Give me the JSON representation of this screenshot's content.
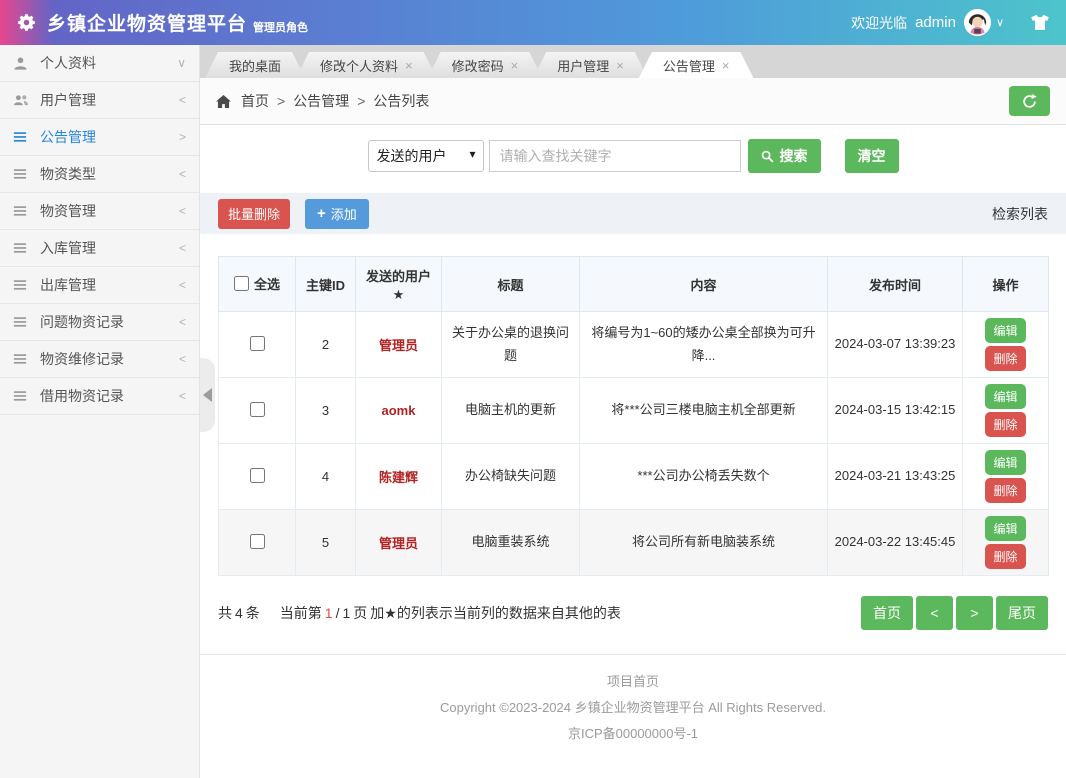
{
  "header": {
    "title": "乡镇企业物资管理平台",
    "role_badge": "管理员角色",
    "welcome": "欢迎光临",
    "username": "admin"
  },
  "sidebar": {
    "items": [
      {
        "label": "个人资料",
        "icon": "user-icon",
        "chevron": "∨",
        "active": false
      },
      {
        "label": "用户管理",
        "icon": "users-icon",
        "chevron": "<",
        "active": false
      },
      {
        "label": "公告管理",
        "icon": "menu-icon",
        "chevron": ">",
        "active": true
      },
      {
        "label": "物资类型",
        "icon": "menu-icon",
        "chevron": "<",
        "active": false
      },
      {
        "label": "物资管理",
        "icon": "menu-icon",
        "chevron": "<",
        "active": false
      },
      {
        "label": "入库管理",
        "icon": "menu-icon",
        "chevron": "<",
        "active": false
      },
      {
        "label": "出库管理",
        "icon": "menu-icon",
        "chevron": "<",
        "active": false
      },
      {
        "label": "问题物资记录",
        "icon": "menu-icon",
        "chevron": "<",
        "active": false
      },
      {
        "label": "物资维修记录",
        "icon": "menu-icon",
        "chevron": "<",
        "active": false
      },
      {
        "label": "借用物资记录",
        "icon": "menu-icon",
        "chevron": "<",
        "active": false
      }
    ]
  },
  "tabs": [
    {
      "label": "我的桌面",
      "closable": false,
      "active": false
    },
    {
      "label": "修改个人资料",
      "closable": true,
      "active": false
    },
    {
      "label": "修改密码",
      "closable": true,
      "active": false
    },
    {
      "label": "用户管理",
      "closable": true,
      "active": false
    },
    {
      "label": "公告管理",
      "closable": true,
      "active": true
    }
  ],
  "tab_close_glyph": "×",
  "breadcrumb": {
    "items": [
      "首页",
      "公告管理",
      "公告列表"
    ],
    "separator": ">"
  },
  "search": {
    "select_value": "发送的用户",
    "input_placeholder": "请输入查找关键字",
    "search_label": "搜索",
    "clear_label": "清空"
  },
  "toolbar": {
    "batch_delete_label": "批量删除",
    "add_plus": "+",
    "add_label": "添加",
    "list_hint": "检索列表"
  },
  "table": {
    "select_all_label": "全选",
    "columns": [
      {
        "label": "主键ID",
        "starred": false
      },
      {
        "label": "发送的用户",
        "starred": true
      },
      {
        "label": "标题",
        "starred": false
      },
      {
        "label": "内容",
        "starred": false
      },
      {
        "label": "发布时间",
        "starred": false
      },
      {
        "label": "操作",
        "starred": false
      }
    ],
    "star_glyph": "★",
    "edit_label": "编辑",
    "delete_label": "删除",
    "rows": [
      {
        "id": "2",
        "user": "管理员",
        "title": "关于办公桌的退换问题",
        "content": "将编号为1~60的矮办公桌全部换为可升降...",
        "time": "2024-03-07 13:39:23"
      },
      {
        "id": "3",
        "user": "aomk",
        "title": "电脑主机的更新",
        "content": "将***公司三楼电脑主机全部更新",
        "time": "2024-03-15 13:42:15"
      },
      {
        "id": "4",
        "user": "陈建辉",
        "title": "办公椅缺失问题",
        "content": "***公司办公椅丢失数个",
        "time": "2024-03-21 13:43:25"
      },
      {
        "id": "5",
        "user": "管理员",
        "title": "电脑重装系统",
        "content": "将公司所有新电脑装系统",
        "time": "2024-03-22 13:45:45"
      }
    ]
  },
  "pagination": {
    "total_prefix": "共",
    "total_count": "4",
    "total_suffix": "条",
    "current_prefix": "当前第",
    "current_page": "1",
    "slash": "/",
    "total_pages": "1",
    "page_suffix": "页",
    "note": "加★的列表示当前列的数据来自其他的表",
    "buttons": [
      {
        "label": "首页",
        "name": "first"
      },
      {
        "label": "<",
        "name": "prev"
      },
      {
        "label": ">",
        "name": "next"
      },
      {
        "label": "尾页",
        "name": "last"
      }
    ]
  },
  "footer": {
    "line1": "项目首页",
    "line2": "Copyright ©2023-2024 乡镇企业物资管理平台 All Rights Reserved.",
    "line3": "京ICP备00000000号-1"
  },
  "colors": {
    "header_gradient": [
      "#e8478d",
      "#6365c6",
      "#5a7ed2",
      "#4e9cda",
      "#4dc4cb"
    ],
    "accent_green": "#5cb85c",
    "danger_red": "#d9534f",
    "primary_blue": "#559bdb",
    "active_menu_blue": "#2786d8",
    "username_red": "#b22222",
    "current_page_red": "#e74c3c"
  }
}
